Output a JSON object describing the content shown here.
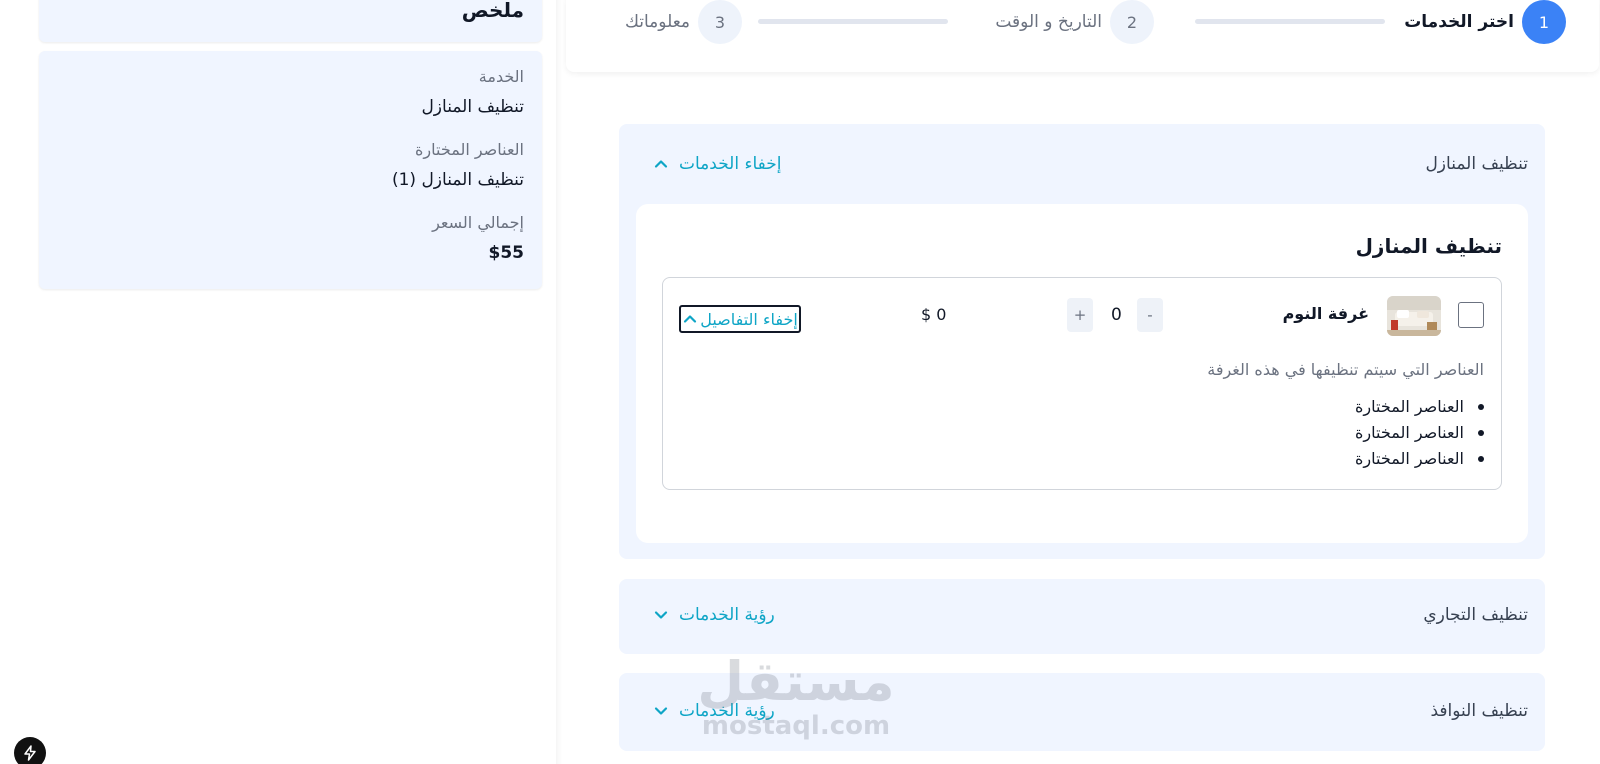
{
  "summary": {
    "title": "ملخص",
    "service_label": "الخدمة",
    "service_value": "تنظيف المنازل",
    "items_label": "العناصر المختارة",
    "items_value": "تنظيف المنازل (1)",
    "total_label": "إجمالي السعر",
    "total_value": "$55"
  },
  "stepper": {
    "steps": [
      {
        "number": "1",
        "label": "اختر الخدمات",
        "active": true
      },
      {
        "number": "2",
        "label": "التاريخ و الوقت",
        "active": false
      },
      {
        "number": "3",
        "label": "معلوماتك",
        "active": false
      }
    ],
    "colors": {
      "active": "#3b82f6",
      "idle": "#eef3fb"
    }
  },
  "services": [
    {
      "name": "تنظيف المنازل",
      "toggle_label": "إخفاء الخدمات",
      "toggle_icon": "chevron-up-icon",
      "expanded": true,
      "card_title": "تنظيف المنازل",
      "room": {
        "name": "غرفة النوم",
        "minus": "-",
        "quantity": "0",
        "plus": "+",
        "price": "$ 0",
        "details_toggle": "إخفاء التفاصيل",
        "details_description": "العناصر التي سيتم تنظيفها في هذه الغرفة",
        "details_items": [
          "العناصر المختارة",
          "العناصر المختارة",
          "العناصر المختارة"
        ]
      }
    },
    {
      "name": "تنظيف التجاري",
      "toggle_label": "رؤية الخدمات",
      "toggle_icon": "chevron-down-icon",
      "expanded": false
    },
    {
      "name": "تنظيف النوافذ",
      "toggle_label": "رؤية الخدمات",
      "toggle_icon": "chevron-down-icon",
      "expanded": false
    }
  ],
  "watermark": {
    "arabic": "مستقل",
    "latin": "mostaql.com"
  },
  "accent_color": "#0ea5c6",
  "badge_icon": "lightning-bolt-icon"
}
